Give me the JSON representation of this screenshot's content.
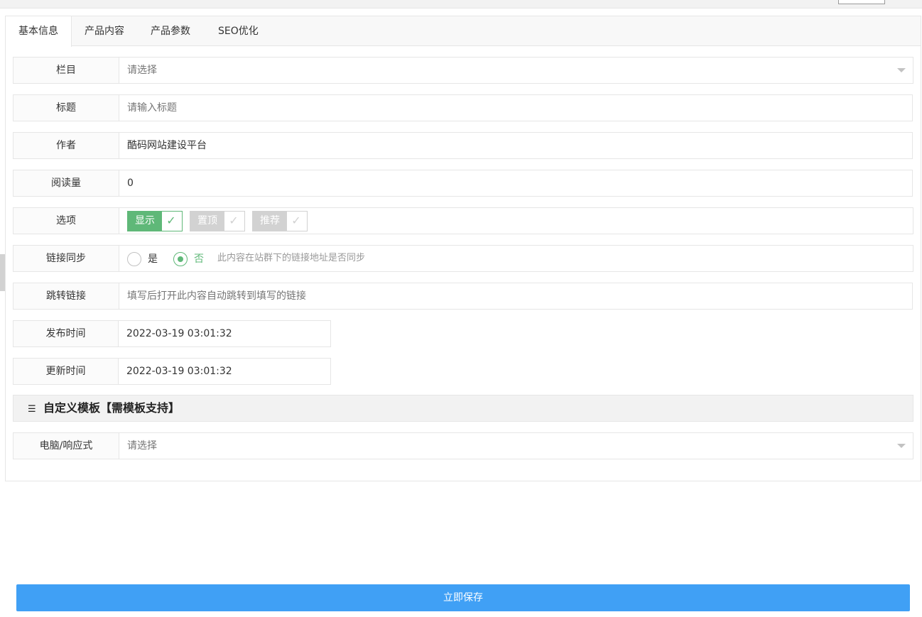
{
  "tabs": [
    {
      "label": "基本信息",
      "active": true
    },
    {
      "label": "产品内容",
      "active": false
    },
    {
      "label": "产品参数",
      "active": false
    },
    {
      "label": "SEO优化",
      "active": false
    }
  ],
  "form": {
    "category": {
      "label": "栏目",
      "value": "",
      "placeholder": "请选择"
    },
    "title": {
      "label": "标题",
      "value": "",
      "placeholder": "请输入标题"
    },
    "author": {
      "label": "作者",
      "value": "酷码网站建设平台"
    },
    "views": {
      "label": "阅读量",
      "value": "0"
    },
    "options": {
      "label": "选项",
      "items": [
        {
          "label": "显示",
          "checked": true
        },
        {
          "label": "置顶",
          "checked": false
        },
        {
          "label": "推荐",
          "checked": false
        }
      ]
    },
    "link_sync": {
      "label": "链接同步",
      "yes": "是",
      "no": "否",
      "selected": "否",
      "hint": "此内容在站群下的链接地址是否同步"
    },
    "redirect": {
      "label": "跳转链接",
      "value": "",
      "placeholder": "填写后打开此内容自动跳转到填写的链接"
    },
    "publish_time": {
      "label": "发布时间",
      "value": "2022-03-19 03:01:32"
    },
    "update_time": {
      "label": "更新时间",
      "value": "2022-03-19 03:01:32"
    }
  },
  "custom_template": {
    "title": "自定义模板【需模板支持】",
    "icon": "sliders-icon",
    "pc_template": {
      "label": "电脑/响应式",
      "value": "",
      "placeholder": "请选择"
    }
  },
  "save_button": {
    "label": "立即保存"
  },
  "colors": {
    "accent_green": "#5fb878",
    "primary_blue": "#40a0f5",
    "border": "#e6e6e6"
  }
}
